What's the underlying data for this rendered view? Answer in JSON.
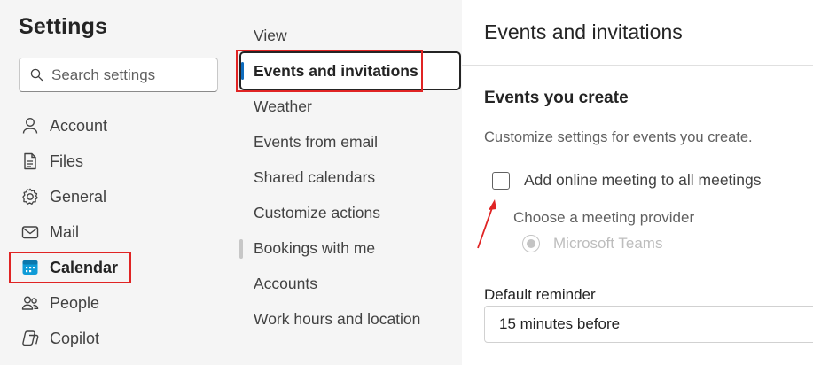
{
  "left": {
    "title": "Settings",
    "search_placeholder": "Search settings",
    "nav": [
      {
        "label": "Account",
        "icon": "person-icon"
      },
      {
        "label": "Files",
        "icon": "document-icon"
      },
      {
        "label": "General",
        "icon": "gear-icon"
      },
      {
        "label": "Mail",
        "icon": "mail-icon"
      },
      {
        "label": "Calendar",
        "icon": "calendar-icon",
        "active": true
      },
      {
        "label": "People",
        "icon": "people-icon"
      },
      {
        "label": "Copilot",
        "icon": "copilot-icon"
      }
    ]
  },
  "middle": {
    "items": [
      {
        "label": "View"
      },
      {
        "label": "Events and invitations",
        "active": true
      },
      {
        "label": "Weather"
      },
      {
        "label": "Events from email"
      },
      {
        "label": "Shared calendars"
      },
      {
        "label": "Customize actions"
      },
      {
        "label": "Bookings with me"
      },
      {
        "label": "Accounts"
      },
      {
        "label": "Work hours and location"
      }
    ]
  },
  "right": {
    "title": "Events and invitations",
    "section_title": "Events you create",
    "section_desc": "Customize settings for events you create.",
    "checkbox_label": "Add online meeting to all meetings",
    "checkbox_checked": false,
    "provider_label": "Choose a meeting provider",
    "provider_option": "Microsoft Teams",
    "reminder_label": "Default reminder",
    "reminder_value": "15 minutes before"
  },
  "colors": {
    "accent": "#0f6cbd",
    "highlight_red": "#e02424",
    "calendar_icon": "#0f9bd7"
  }
}
